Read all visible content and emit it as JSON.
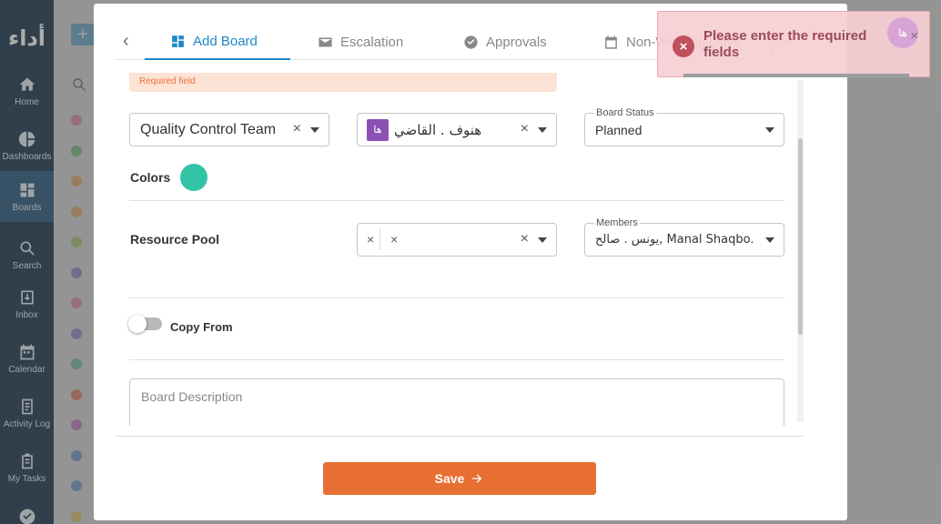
{
  "app": {
    "logo": "أداء"
  },
  "sidebar": {
    "items": [
      {
        "label": "Home",
        "icon": "home-icon"
      },
      {
        "label": "Dashboards",
        "icon": "pie-chart-icon"
      },
      {
        "label": "Boards",
        "icon": "boards-icon",
        "active": true
      },
      {
        "label": "Search",
        "icon": "search-icon"
      },
      {
        "label": "Inbox",
        "icon": "inbox-icon"
      },
      {
        "label": "Calendar",
        "icon": "calendar-icon"
      },
      {
        "label": "Activity Log",
        "icon": "activity-log-icon"
      },
      {
        "label": "My Tasks",
        "icon": "clipboard-icon"
      }
    ]
  },
  "background": {
    "add_label": "+",
    "dot_colors": [
      "#e0557a",
      "#2ea84a",
      "#e3891d",
      "#e3891d",
      "#8fb82a",
      "#6a4fc4",
      "#e0557a",
      "#6a4fc4",
      "#2ea88a",
      "#e04a23",
      "#b23db8",
      "#2f6fc4",
      "#2f6fc4",
      "#e0b21d"
    ]
  },
  "modal": {
    "tabs": [
      {
        "label": "Add Board",
        "icon": "grid-icon",
        "active": true
      },
      {
        "label": "Escalation",
        "icon": "envelope-icon"
      },
      {
        "label": "Approvals",
        "icon": "check-circle-icon"
      },
      {
        "label": "Non-Working Days",
        "icon": "calendar-icon"
      }
    ],
    "required_field": "Required field",
    "team_select": {
      "value": "Quality Control Team"
    },
    "owner_select": {
      "value": "هنوف . القاضي",
      "chip": "ها"
    },
    "board_status": {
      "label": "Board Status",
      "value": "Planned"
    },
    "colors_label": "Colors",
    "color_value": "#33c4a8",
    "resource_pool_label": "Resource Pool",
    "members": {
      "label": "Members",
      "value": "يونس . صالح, Manal Shaqbo..."
    },
    "copy_from_label": "Copy From",
    "description_placeholder": "Board Description",
    "save_label": "Save"
  },
  "toast": {
    "message": "Please enter the required fields",
    "avatar": "ها"
  }
}
